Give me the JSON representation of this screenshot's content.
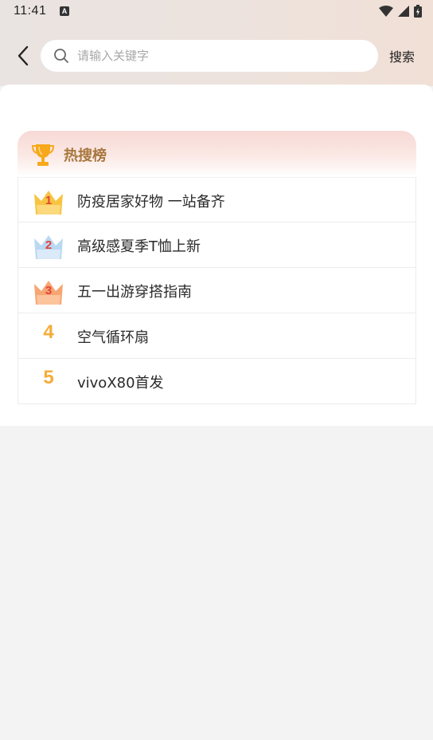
{
  "status_bar": {
    "time": "11:41",
    "notification_glyph": "A"
  },
  "search": {
    "placeholder": "请输入关键字",
    "value": "",
    "submit_label": "搜索"
  },
  "hot_list": {
    "title": "热搜榜",
    "items": [
      {
        "rank": "1",
        "text": "防疫居家好物 一站备齐",
        "badge_color": "#f7c542"
      },
      {
        "rank": "2",
        "text": "高级感夏季T恤上新",
        "badge_color": "#b9d8f2"
      },
      {
        "rank": "3",
        "text": "五一出游穿搭指南",
        "badge_color": "#f6a672"
      },
      {
        "rank": "4",
        "text": "空气循环扇"
      },
      {
        "rank": "5",
        "text": "vivoX80首发"
      }
    ]
  },
  "colors": {
    "accent_title": "#a8773e",
    "rank_number": "#f4ac3a",
    "badge_digit": "#e5423a"
  }
}
